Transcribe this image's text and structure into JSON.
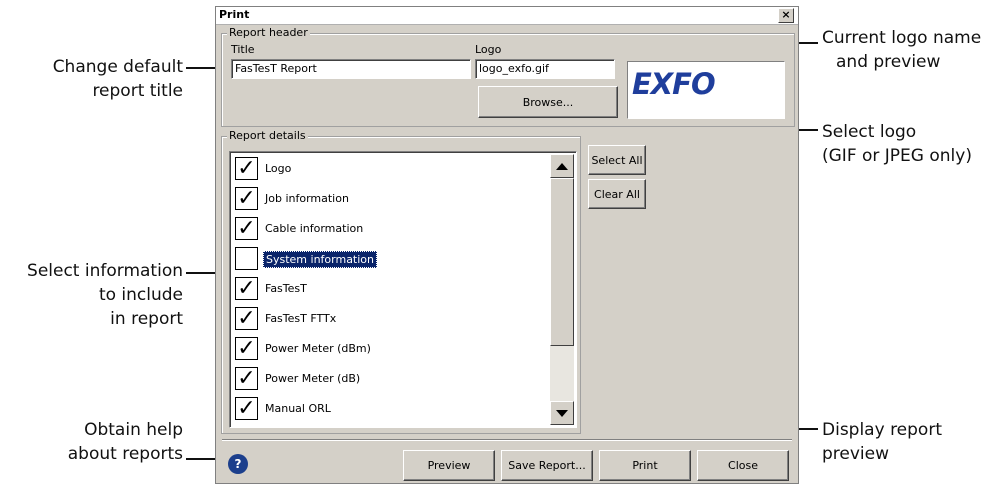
{
  "dialog": {
    "title": "Print",
    "close_glyph": "×",
    "report_header": {
      "legend": "Report header",
      "title_label": "Title",
      "title_value": "FasTesT Report",
      "logo_label": "Logo",
      "logo_value": "logo_exfo.gif",
      "browse_label": "Browse...",
      "logo_preview_text": "EXFO",
      "logo_preview_color": "#1f3e9c"
    },
    "report_details": {
      "legend": "Report details",
      "items": [
        {
          "label": "Logo",
          "checked": true,
          "mark": "✓"
        },
        {
          "label": "Job information",
          "checked": true,
          "mark": "✓"
        },
        {
          "label": "Cable information",
          "checked": true,
          "mark": "✓"
        },
        {
          "label": "System information",
          "checked": false,
          "mark": "",
          "selected": true
        },
        {
          "label": "FasTesT",
          "checked": true,
          "mark": "✓"
        },
        {
          "label": "FasTesT FTTx",
          "checked": true,
          "mark": "✓"
        },
        {
          "label": "Power Meter (dBm)",
          "checked": true,
          "mark": "✓"
        },
        {
          "label": "Power Meter (dB)",
          "checked": true,
          "mark": "✓"
        },
        {
          "label": "Manual ORL",
          "checked": true,
          "mark": "✓"
        }
      ],
      "select_all_label": "Select All",
      "clear_all_label": "Clear All"
    },
    "footer": {
      "help_glyph": "?",
      "preview_label": "Preview",
      "save_report_label": "Save Report...",
      "print_label": "Print",
      "close_label": "Close"
    }
  },
  "callouts": {
    "change_title": [
      "Change default",
      "report title"
    ],
    "current_logo": [
      "Current logo name",
      "and preview"
    ],
    "select_logo": [
      "Select logo",
      "(GIF or JPEG only)"
    ],
    "select_info": [
      "Select information",
      "to include",
      "in report"
    ],
    "obtain_help": [
      "Obtain help",
      "about reports"
    ],
    "display_preview": [
      "Display report",
      "preview"
    ]
  }
}
